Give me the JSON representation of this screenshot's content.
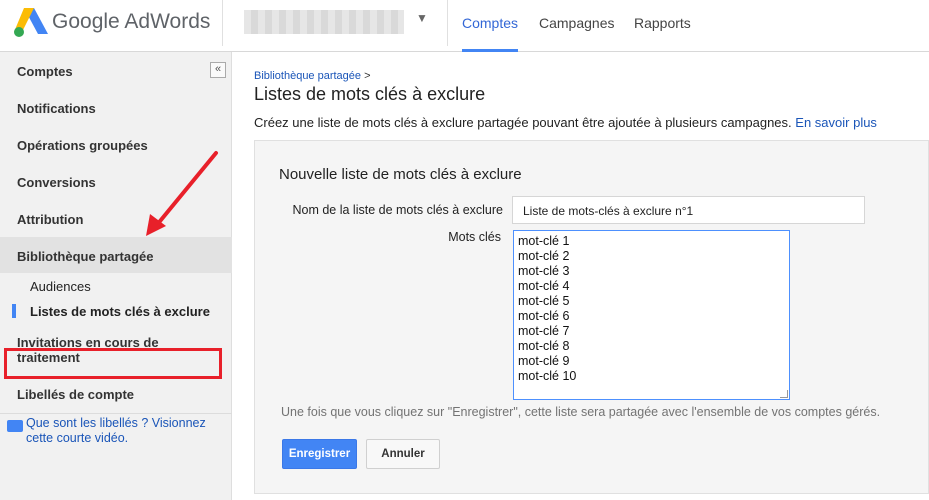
{
  "header": {
    "brand": "Google AdWords",
    "nav": [
      {
        "label": "Comptes",
        "active": true
      },
      {
        "label": "Campagnes",
        "active": false
      },
      {
        "label": "Rapports",
        "active": false
      }
    ]
  },
  "sidebar": {
    "collapse_label": "«",
    "items": [
      {
        "label": "Comptes"
      },
      {
        "label": "Notifications"
      },
      {
        "label": "Opérations groupées"
      },
      {
        "label": "Conversions"
      },
      {
        "label": "Attribution"
      },
      {
        "label": "Bibliothèque partagée"
      }
    ],
    "subitems": [
      {
        "label": "Audiences"
      },
      {
        "label": "Listes de mots clés à exclure"
      }
    ],
    "more_items": [
      {
        "label": "Invitations en cours de traitement"
      },
      {
        "label": "Libellés de compte"
      }
    ],
    "help_link": "Que sont les libellés ? Visionnez cette courte vidéo."
  },
  "main": {
    "breadcrumb": "Bibliothèque partagée",
    "breadcrumb_sep": ">",
    "title": "Listes de mots clés à exclure",
    "intro": "Créez une liste de mots clés à exclure partagée pouvant être ajoutée à plusieurs campagnes.",
    "intro_link": "En savoir plus",
    "panel": {
      "title": "Nouvelle liste de mots clés à exclure",
      "name_label": "Nom de la liste de mots clés à exclure",
      "name_value": "Liste de mots-clés à exclure n°1",
      "keywords_label": "Mots clés",
      "keywords": [
        "mot-clé 1",
        "mot-clé 2",
        "mot-clé 3",
        "mot-clé 4",
        "mot-clé 5",
        "mot-clé 6",
        "mot-clé 7",
        "mot-clé 8",
        "mot-clé 9",
        "mot-clé 10"
      ],
      "note": "Une fois que vous cliquez sur \"Enregistrer\", cette liste sera partagée avec l'ensemble de vos comptes gérés.",
      "save_label": "Enregistrer",
      "cancel_label": "Annuler"
    }
  },
  "colors": {
    "accent": "#4285f4",
    "link": "#1a55b8",
    "highlight_box": "#e8202a"
  }
}
